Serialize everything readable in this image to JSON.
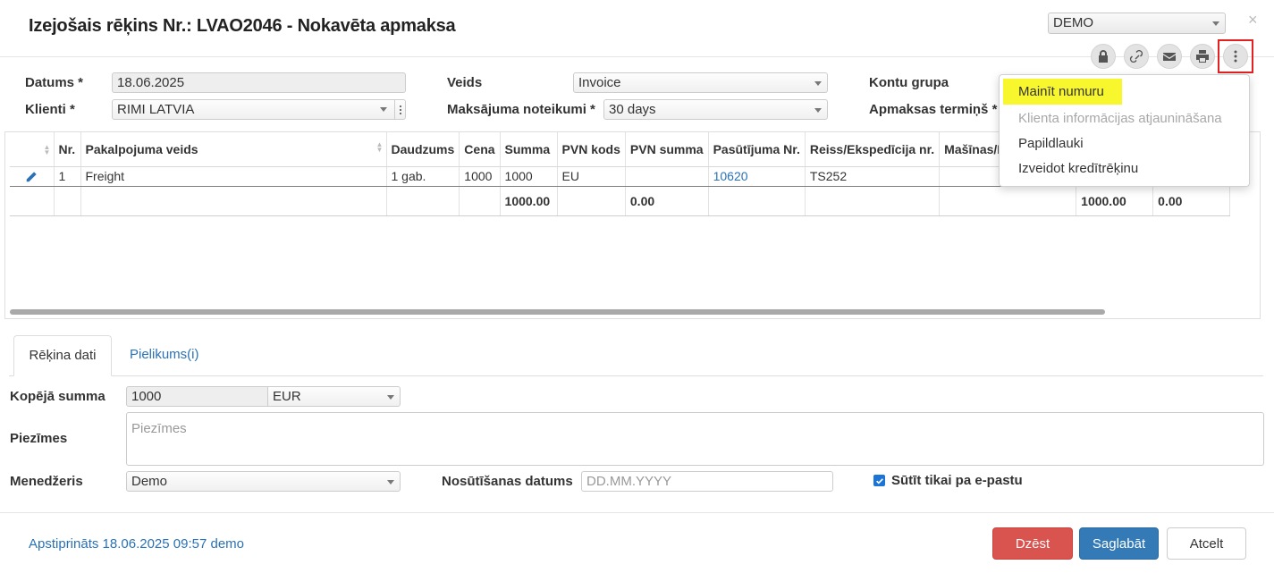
{
  "header": {
    "title": "Izejošais rēķins Nr.: LVAO2046 - Nokavēta apmaksa",
    "company": "DEMO",
    "close": "×"
  },
  "toolbar_icons": [
    "lock-icon",
    "link-icon",
    "envelope-icon",
    "print-icon",
    "more-vertical-icon"
  ],
  "form": {
    "datums_label": "Datums *",
    "datums_value": "18.06.2025",
    "klients_label": "Klienti *",
    "klients_value": "RIMI LATVIA",
    "veids_label": "Veids",
    "veids_value": "Invoice",
    "maksajuma_label": "Maksājuma noteikumi *",
    "maksajuma_value": "30 days",
    "kontu_label": "Kontu grupa",
    "apmaksas_label": "Apmaksas termiņš *"
  },
  "grid": {
    "columns": [
      "Nr.",
      "Pakalpojuma veids",
      "Daudzums",
      "Cena",
      "Summa",
      "PVN kods",
      "PVN summa",
      "Pasūtījuma Nr.",
      "Reiss/Ekspedīcija nr.",
      "Mašīnas/Pie"
    ],
    "row": {
      "nr": "1",
      "service": "Freight",
      "qty": "1 gab.",
      "price": "1000",
      "sum": "1000",
      "vat_code": "EU",
      "vat_sum": "",
      "order_no": "10620",
      "trip": "TS252",
      "truck": ""
    },
    "totals": {
      "sum": "1000.00",
      "vat_sum": "0.00",
      "extra1": "1000.00",
      "extra2": "0.00"
    }
  },
  "menu": {
    "items": [
      "Mainīt numuru",
      "Klienta informācijas atjaunināšana",
      "Papildlauki",
      "Izveidot kredītrēķinu"
    ]
  },
  "tabs": {
    "active": "Rēķina dati",
    "other": "Pielikums(i)"
  },
  "details": {
    "total_label": "Kopējā summa",
    "total_value": "1000",
    "currency": "EUR",
    "notes_label": "Piezīmes",
    "notes_placeholder": "Piezīmes",
    "manager_label": "Menedžeris",
    "manager_value": "Demo",
    "send_date_label": "Nosūtīšanas datums",
    "send_date_placeholder": "DD.MM.YYYY",
    "email_only_label": "Sūtīt tikai pa e-pastu",
    "email_only_checked": true
  },
  "footer": {
    "status": "Apstiprināts 18.06.2025 09:57 demo",
    "delete_label": "Dzēst",
    "save_label": "Saglabāt",
    "cancel_label": "Atcelt"
  },
  "colors": {
    "accent": "#337ab7",
    "danger": "#d9534f",
    "highlight": "#f8f72d",
    "link": "#2a72b5"
  }
}
